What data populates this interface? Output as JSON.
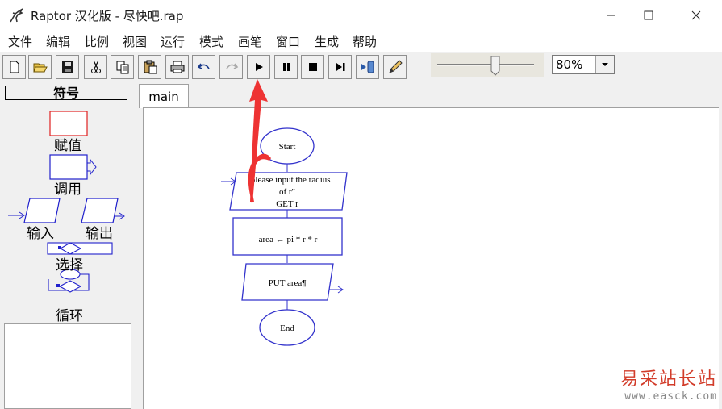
{
  "window": {
    "title": "Raptor 汉化版 - 尽快吧.rap"
  },
  "menu": [
    "文件",
    "编辑",
    "比例",
    "视图",
    "运行",
    "模式",
    "画笔",
    "窗口",
    "生成",
    "帮助"
  ],
  "toolbar": {
    "buttons": [
      "new-file-icon",
      "open-folder-icon",
      "save-icon",
      "cut-icon",
      "copy-icon",
      "paste-icon",
      "print-icon",
      "undo-icon",
      "redo-icon",
      "play-icon",
      "pause-icon",
      "stop-icon",
      "step-icon",
      "test-server-icon",
      "pen-icon"
    ],
    "zoom": {
      "value": "80%"
    },
    "speed_slider_level": 0.6
  },
  "symbols": {
    "title": "符号",
    "items": [
      "赋值",
      "调用",
      "输入",
      "输出",
      "选择",
      "循环"
    ]
  },
  "tabs": [
    {
      "label": "main"
    }
  ],
  "flowchart": {
    "start": "Start",
    "input_text_1": "\"please input the radius",
    "input_text_2": "of r\"",
    "input_text_3": "GET r",
    "assign": "area ← pi * r * r",
    "output": "PUT area¶",
    "end": "End"
  },
  "watermark": {
    "main": "易采站长站",
    "sub": "www.easck.com"
  },
  "colors": {
    "flow_blue": "#3333cc",
    "arrow_red": "#ee3333",
    "assign_red": "#e02020"
  }
}
